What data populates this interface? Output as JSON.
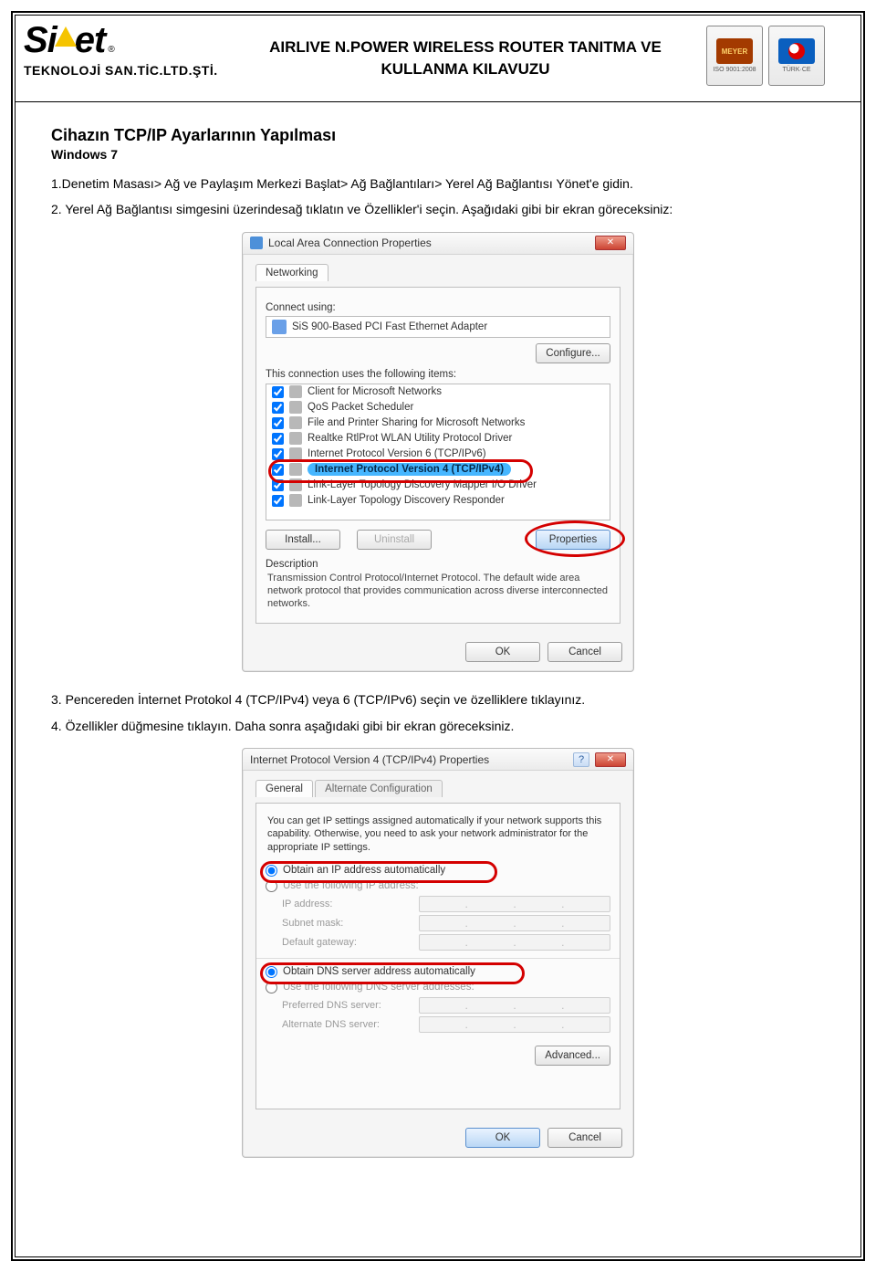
{
  "header": {
    "logo_text_1": "Si",
    "logo_text_2": "et",
    "logo_reg": "®",
    "logo_sub": "TEKNOLOJİ SAN.TİC.LTD.ŞTİ.",
    "doc_title_l1": "AIRLIVE N.POWER WIRELESS ROUTER TANITMA VE",
    "doc_title_l2": "KULLANMA KILAVUZU",
    "badge1_brand": "MEYER",
    "badge1_line": "ISO 9001:2008",
    "badge2_brand": "TÜRK·CE"
  },
  "section": {
    "title": "Cihazın TCP/IP Ayarlarının Yapılması",
    "subtitle": "Windows 7"
  },
  "steps": {
    "s1": "1.Denetim Masası> Ağ ve Paylaşım Merkezi Başlat> Ağ Bağlantıları> Yerel Ağ Bağlantısı Yönet'e gidin.",
    "s2": "2. Yerel Ağ Bağlantısı simgesini üzerindesağ tıklatın ve Özellikler'i seçin. Aşağıdaki gibi bir ekran göreceksiniz:",
    "s3": "3. Pencereden İnternet Protokol 4 (TCP/IPv4) veya 6 (TCP/IPv6) seçin ve özelliklere tıklayınız.",
    "s4": "4. Özellikler düğmesine tıklayın. Daha sonra aşağıdaki gibi bir ekran göreceksiniz."
  },
  "dlg1": {
    "title": "Local Area Connection Properties",
    "tab": "Networking",
    "connect_using_lbl": "Connect using:",
    "adapter": "SiS 900-Based PCI Fast Ethernet Adapter",
    "configure": "Configure...",
    "items_lbl": "This connection uses the following items:",
    "items": [
      "Client for Microsoft Networks",
      "QoS Packet Scheduler",
      "File and Printer Sharing for Microsoft Networks",
      "Realtke RtlProt WLAN Utility Protocol Driver",
      "Internet Protocol Version 6 (TCP/IPv6)",
      "Internet Protocol Version 4 (TCP/IPv4)",
      "Link-Layer Topology Discovery Mapper I/O Driver",
      "Link-Layer Topology Discovery Responder"
    ],
    "install": "Install...",
    "uninstall": "Uninstall",
    "properties": "Properties",
    "desc_lbl": "Description",
    "desc": "Transmission Control Protocol/Internet Protocol. The default wide area network protocol that provides communication across diverse interconnected networks.",
    "ok": "OK",
    "cancel": "Cancel"
  },
  "dlg2": {
    "title": "Internet Protocol Version 4 (TCP/IPv4) Properties",
    "tab_general": "General",
    "tab_alt": "Alternate Configuration",
    "intro": "You can get IP settings assigned automatically if your network supports this capability. Otherwise, you need to ask your network administrator for the appropriate IP settings.",
    "r_auto_ip": "Obtain an IP address automatically",
    "r_use_ip": "Use the following IP address:",
    "f_ip": "IP address:",
    "f_mask": "Subnet mask:",
    "f_gw": "Default gateway:",
    "r_auto_dns": "Obtain DNS server address automatically",
    "r_use_dns": "Use the following DNS server addresses:",
    "f_dns1": "Preferred DNS server:",
    "f_dns2": "Alternate DNS server:",
    "advanced": "Advanced...",
    "ok": "OK",
    "cancel": "Cancel"
  }
}
